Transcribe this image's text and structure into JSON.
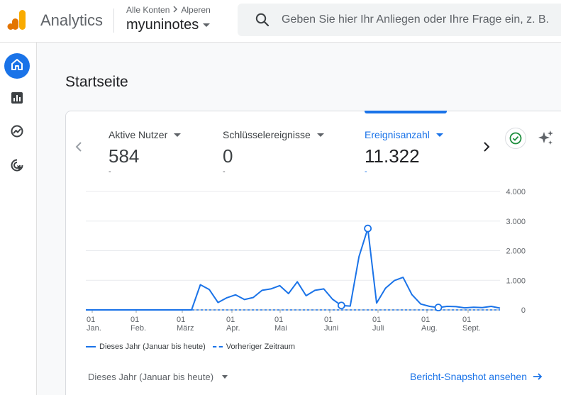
{
  "header": {
    "app_name": "Analytics",
    "breadcrumb": [
      "Alle Konten",
      "Alperen"
    ],
    "property_name": "myuninotes",
    "search_placeholder": "Geben Sie hier Ihr Anliegen oder Ihre Frage ein, z. B."
  },
  "sidebar": {
    "items": [
      {
        "name": "home",
        "icon": "home-icon",
        "active": true
      },
      {
        "name": "reports",
        "icon": "bar-chart-icon",
        "active": false
      },
      {
        "name": "explore",
        "icon": "explore-icon",
        "active": false
      },
      {
        "name": "advertising",
        "icon": "cursor-target-icon",
        "active": false
      }
    ]
  },
  "page": {
    "title": "Startseite"
  },
  "card": {
    "metrics": [
      {
        "label": "Aktive Nutzer",
        "value": "584",
        "delta": "-",
        "selected": false
      },
      {
        "label": "Schlüsselereignisse",
        "value": "0",
        "delta": "-",
        "selected": false
      },
      {
        "label": "Ereignisanzahl",
        "value": "11.322",
        "delta": "-",
        "selected": true
      }
    ],
    "legend": {
      "current": "Dieses Jahr (Januar bis heute)",
      "previous": "Vorheriger Zeitraum"
    },
    "date_range": "Dieses Jahr (Januar bis heute)",
    "snapshot_link": "Bericht-Snapshot ansehen"
  },
  "colors": {
    "accent": "#1a73e8",
    "logo_orange": "#f9ab00",
    "logo_dark_orange": "#e37400",
    "check_green": "#1e8e3e"
  },
  "chart_data": {
    "type": "line",
    "x_tick_labels": [
      [
        "01",
        "Jan."
      ],
      [
        "01",
        "Feb."
      ],
      [
        "01",
        "März"
      ],
      [
        "01",
        "Apr."
      ],
      [
        "01",
        "Mai"
      ],
      [
        "01",
        "Juni"
      ],
      [
        "01",
        "Juli"
      ],
      [
        "01",
        "Aug."
      ],
      [
        "01",
        "Sept."
      ]
    ],
    "y_tick_labels": [
      "4.000",
      "3.000",
      "2.000",
      "1.000",
      "0"
    ],
    "ylim": [
      0,
      4000
    ],
    "grid": true,
    "y_axis_position": "right",
    "legend_placement": "bottom-left",
    "series": [
      {
        "name": "Dieses Jahr (Januar bis heute)",
        "style": "solid",
        "values": [
          0,
          0,
          0,
          0,
          0,
          0,
          0,
          0,
          0,
          0,
          0,
          0,
          0,
          850,
          690,
          250,
          410,
          510,
          350,
          420,
          660,
          710,
          820,
          550,
          950,
          480,
          660,
          710,
          360,
          150,
          130,
          1800,
          2750,
          230,
          730,
          990,
          1100,
          520,
          200,
          120,
          80,
          120,
          110,
          70,
          90,
          80,
          120,
          60
        ],
        "x_index": [
          0,
          1,
          2,
          3,
          4,
          5,
          6,
          7,
          8,
          9,
          10,
          11,
          12,
          13,
          14,
          15,
          16,
          17,
          18,
          19,
          20,
          21,
          22,
          23,
          24,
          25,
          26,
          27,
          28,
          29,
          30,
          31,
          32,
          33,
          34,
          35,
          36,
          37,
          38,
          39,
          40,
          41,
          42,
          43,
          44,
          45,
          46,
          47
        ]
      },
      {
        "name": "Vorheriger Zeitraum",
        "style": "dashed",
        "values": [
          0,
          0,
          0,
          0,
          0,
          0,
          0,
          0,
          0,
          0,
          0,
          0,
          0,
          0,
          0,
          0,
          0,
          0,
          0,
          0,
          0,
          0,
          0,
          0,
          0,
          0,
          0,
          0,
          0,
          0,
          0,
          0,
          0,
          0,
          0,
          0,
          0,
          0,
          0,
          0,
          0,
          0,
          0,
          0,
          0,
          0,
          0,
          0
        ]
      }
    ],
    "highlighted_points": [
      {
        "series": 0,
        "x_index": 29
      },
      {
        "series": 0,
        "x_index": 32
      },
      {
        "series": 0,
        "x_index": 40
      }
    ]
  }
}
